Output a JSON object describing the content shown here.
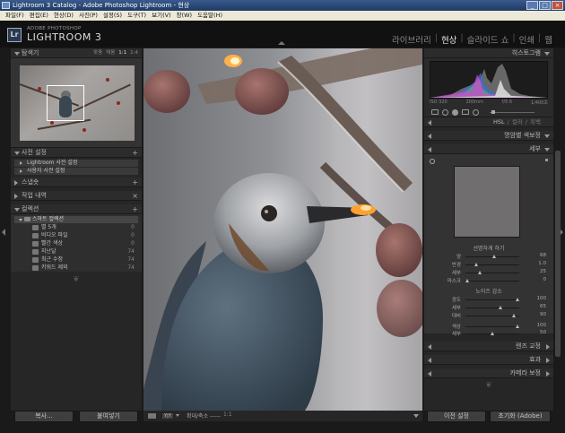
{
  "window": {
    "title": "Lightroom 3 Catalog - Adobe Photoshop Lightroom - 현상",
    "controls": [
      "_",
      "□",
      "×"
    ]
  },
  "menu": [
    "파일(F)",
    "편집(E)",
    "현상(D)",
    "사진(P)",
    "설정(S)",
    "도구(T)",
    "보기(V)",
    "창(W)",
    "도움말(H)"
  ],
  "header": {
    "logo": "Lr",
    "brand_top": "ADOBE PHOTOSHOP",
    "brand": "LIGHTROOM 3",
    "modules": [
      "라이브러리",
      "현상",
      "슬라이드 쇼",
      "인쇄",
      "웹"
    ],
    "active_module": "현상"
  },
  "left": {
    "navigator": {
      "title": "탐색기",
      "zoom": [
        "맞춤",
        "채움",
        "1:1",
        "1:4"
      ]
    },
    "presets": {
      "title": "사전 설정",
      "items": [
        "Lightroom 사전 설정",
        "사용자 사전 설정"
      ]
    },
    "snapshots": {
      "title": "스냅숏"
    },
    "history": {
      "title": "작업 내역"
    },
    "collections": {
      "title": "컬렉션",
      "set": "스마트 컬렉션",
      "items": [
        {
          "label": "별 5개",
          "count": "0"
        },
        {
          "label": "비디오 파일",
          "count": "0"
        },
        {
          "label": "빨간 색상",
          "count": "0"
        },
        {
          "label": "지난달",
          "count": "74"
        },
        {
          "label": "최근 수정",
          "count": "74"
        },
        {
          "label": "키워드 제외",
          "count": "74"
        }
      ]
    },
    "buttons": {
      "copy": "복사...",
      "paste": "붙여넣기"
    }
  },
  "toolbar": {
    "yy": "Y|Y",
    "zoom_label": "확대/축소",
    "zoom_value": "1:1"
  },
  "right": {
    "histogram": {
      "title": "히스토그램",
      "info": [
        "ISO 320",
        "200mm",
        "f/5.6",
        "1/400초"
      ]
    },
    "hsl_tabs": [
      "HSL",
      "/",
      "컬러",
      "/",
      "흑백"
    ],
    "split_toning": {
      "title": "명암별 색보정"
    },
    "detail": {
      "title": "세부",
      "sharpening": {
        "title": "선명하게 하기",
        "sliders": [
          {
            "name": "양",
            "value": "68"
          },
          {
            "name": "반경",
            "value": "1.0"
          },
          {
            "name": "세부",
            "value": "25"
          },
          {
            "name": "마스크",
            "value": "0"
          }
        ]
      },
      "noise": {
        "title": "노이즈 감소",
        "sliders": [
          {
            "name": "광도",
            "value": "100"
          },
          {
            "name": "세부",
            "value": "65"
          },
          {
            "name": "대비",
            "value": "90"
          },
          {
            "name": "색상",
            "value": "100"
          },
          {
            "name": "세부",
            "value": "50"
          }
        ]
      }
    },
    "lens": {
      "title": "렌즈 교정"
    },
    "effects": {
      "title": "효과"
    },
    "camera": {
      "title": "카메라 보정"
    },
    "buttons": {
      "previous": "이전 설정",
      "reset": "초기화 (Adobe)"
    }
  },
  "colors": {
    "background": "#1a1a1a",
    "panel": "#262626",
    "highlight_text": "#e8e8e8"
  }
}
